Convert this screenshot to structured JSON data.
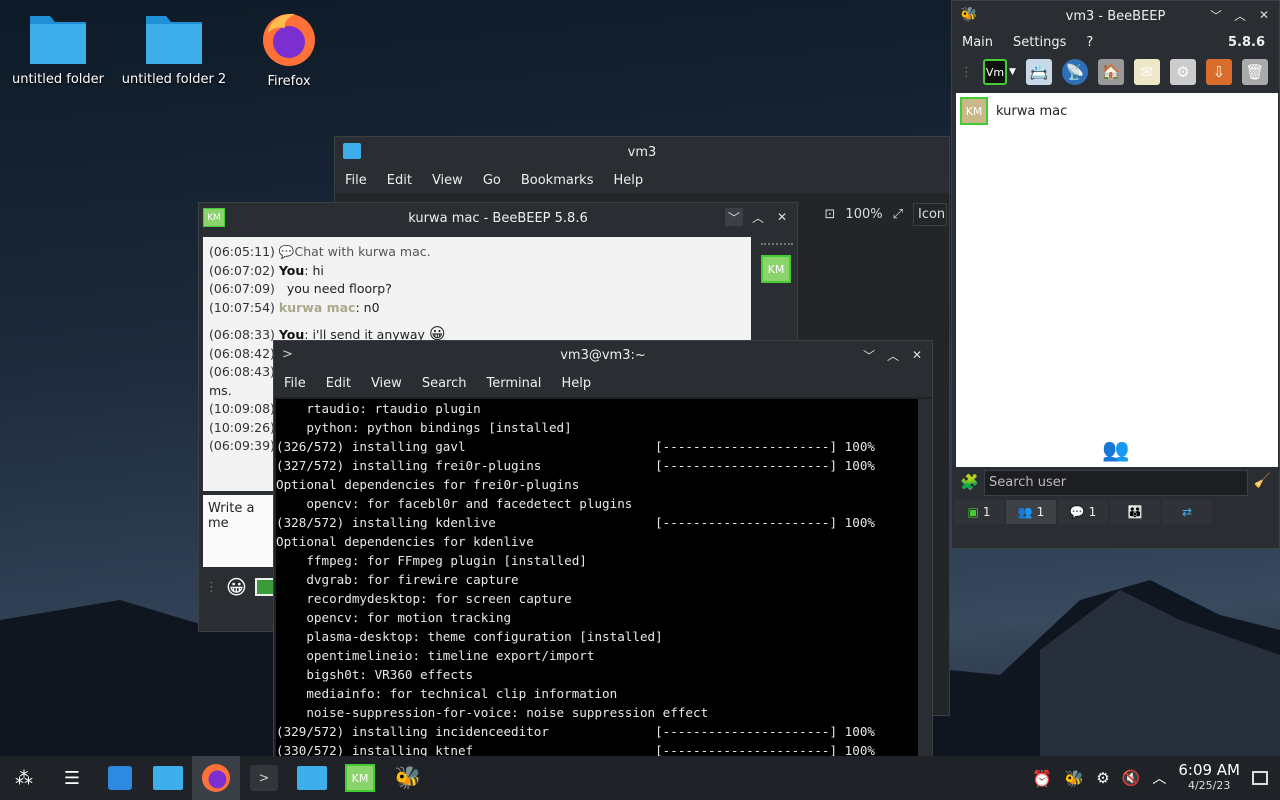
{
  "desktop": {
    "icons": [
      {
        "label": "untitled folder"
      },
      {
        "label": "untitled folder 2"
      },
      {
        "label": "Firefox"
      }
    ]
  },
  "dolphin": {
    "title": "vm3",
    "menu": [
      "File",
      "Edit",
      "View",
      "Go",
      "Bookmarks",
      "Help"
    ],
    "zoom": "100%",
    "view_mode": "Icon"
  },
  "chat": {
    "title": "kurwa mac - BeeBEEP 5.8.6",
    "messages": [
      {
        "time": "(06:05:11)",
        "sender": "",
        "text": "Chat with kurwa mac."
      },
      {
        "time": "(06:07:02)",
        "sender": "You",
        "text": ": hi"
      },
      {
        "time": "(06:07:09)",
        "sender": "",
        "text": "you need floorp?"
      },
      {
        "time": "(10:07:54)",
        "sender": "kurwa mac",
        "text": ": n0"
      },
      {
        "time": "(06:08:33)",
        "sender": "You",
        "text": ": i'll send it anyway"
      },
      {
        "time": "(06:08:42)",
        "sender": "",
        "text": ""
      },
      {
        "time": "(06:08:43)",
        "sender": "",
        "text": ""
      },
      {
        "time": "",
        "sender": "",
        "text": "ms."
      },
      {
        "time": "(10:09:08)",
        "sender": "",
        "text": ""
      },
      {
        "time": "(10:09:26)",
        "sender": "",
        "text": ""
      },
      {
        "time": "(06:09:39)",
        "sender": "",
        "text": ""
      }
    ],
    "input_placeholder": "Write a me",
    "contact_badge": "KM",
    "title_badge": "KM"
  },
  "terminal": {
    "title": "vm3@vm3:~",
    "menu": [
      "File",
      "Edit",
      "View",
      "Search",
      "Terminal",
      "Help"
    ],
    "lines": [
      "    rtaudio: rtaudio plugin",
      "    python: python bindings [installed]",
      "(326/572) installing gavl                         [----------------------] 100%",
      "(327/572) installing frei0r-plugins               [----------------------] 100%",
      "Optional dependencies for frei0r-plugins",
      "    opencv: for facebl0r and facedetect plugins",
      "(328/572) installing kdenlive                     [----------------------] 100%",
      "Optional dependencies for kdenlive",
      "    ffmpeg: for FFmpeg plugin [installed]",
      "    dvgrab: for firewire capture",
      "    recordmydesktop: for screen capture",
      "    opencv: for motion tracking",
      "    plasma-desktop: theme configuration [installed]",
      "    opentimelineio: timeline export/import",
      "    bigsh0t: VR360 effects",
      "    mediainfo: for technical clip information",
      "    noise-suppression-for-voice: noise suppression effect",
      "(329/572) installing incidenceeditor              [----------------------] 100%",
      "(330/572) installing ktnef                        [----------------------] 100%"
    ]
  },
  "beebeep": {
    "title": "vm3 - BeeBEEP",
    "menu": [
      "Main",
      "Settings",
      "?"
    ],
    "version": "5.8.6",
    "status_badge": "Vm",
    "users": [
      {
        "initials": "KM",
        "name": "kurwa mac"
      }
    ],
    "search_placeholder": "Search user",
    "tabs": [
      {
        "icon": "users-icon",
        "count": "1"
      },
      {
        "icon": "group-icon",
        "count": "1"
      },
      {
        "icon": "chat-icon",
        "count": "1"
      },
      {
        "icon": "group-add-icon",
        "count": ""
      },
      {
        "icon": "files-icon",
        "count": ""
      }
    ]
  },
  "taskbar": {
    "time": "6:09 AM",
    "date": "4/25/23",
    "km_badge": "KM"
  }
}
